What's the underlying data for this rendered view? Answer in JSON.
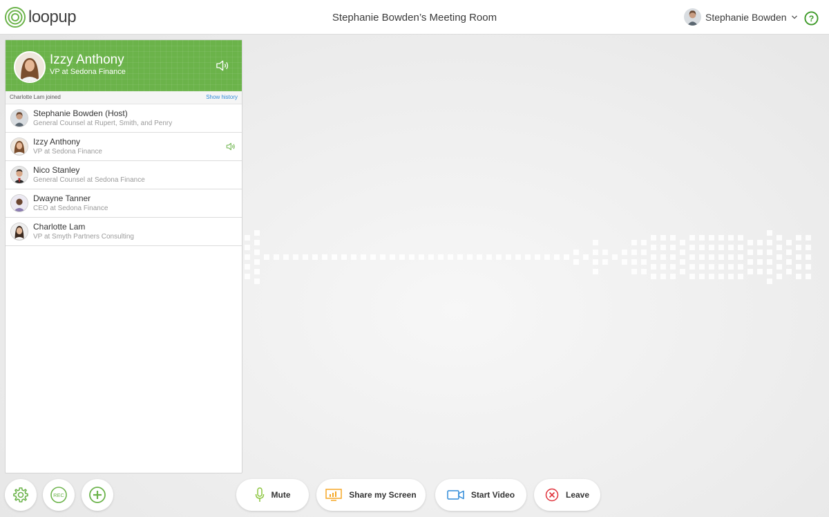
{
  "brand": {
    "name": "loopup",
    "color": "#6bb34a"
  },
  "header": {
    "room_title": "Stephanie Bowden’s Meeting Room",
    "user_name": "Stephanie Bowden",
    "help_icon": "help-circle-icon"
  },
  "active_speaker": {
    "name": "Izzy Anthony",
    "title": "VP at Sedona Finance"
  },
  "activity": {
    "text": "Charlotte Lam joined",
    "history_link": "Show history"
  },
  "participants": [
    {
      "name": "Stephanie Bowden (Host)",
      "title": "General Counsel at Rupert, Smith, and Penry",
      "speaking": false
    },
    {
      "name": "Izzy Anthony",
      "title": "VP at Sedona Finance",
      "speaking": true
    },
    {
      "name": "Nico Stanley",
      "title": "General Counsel at Sedona Finance",
      "speaking": false
    },
    {
      "name": "Dwayne Tanner",
      "title": "CEO at Sedona Finance",
      "speaking": false
    },
    {
      "name": "Charlotte Lam",
      "title": "VP at Smyth Partners Consulting",
      "speaking": false
    }
  ],
  "toolbar": {
    "settings_icon": "gear-icon",
    "record_icon": "rec-icon",
    "record_label": "REC",
    "add_icon": "plus-circle-icon",
    "mute_label": "Mute",
    "share_label": "Share my Screen",
    "video_label": "Start Video",
    "leave_label": "Leave"
  },
  "colors": {
    "green": "#6bb34a",
    "link_blue": "#2e8ad8",
    "mic_green": "#8cc63f",
    "share_orange": "#f5a623",
    "video_blue": "#2e8ad8",
    "leave_red": "#e0313a"
  },
  "audio_levels": [
    0.5,
    0.64,
    0.64,
    0.5,
    0.64,
    0.36,
    0.21,
    0.07,
    0.07,
    0.07,
    0.07,
    0.07,
    0.07,
    0.21,
    0.07,
    0.21,
    0.14,
    0.07,
    0.14,
    0.07,
    0.07,
    0.07,
    0.14,
    0.07,
    0.14,
    0.21,
    0.07,
    0.07,
    0.07,
    0.07,
    0.07,
    0.07,
    0.07,
    0.07,
    0.07,
    0.07,
    0.07,
    0.14,
    0.07,
    0.07,
    0.07,
    0.07,
    0.07,
    0.14,
    0.07,
    0.07,
    0.21,
    0.21,
    0.14,
    0.07,
    0.07,
    0.07,
    0.07,
    0.07,
    0.07,
    0.07,
    0.07,
    0.07,
    0.07,
    0.07,
    0.07,
    0.14,
    0.07,
    0.07,
    0.07,
    0.21,
    0.14,
    0.07,
    0.07,
    0.07,
    0.07,
    0.07,
    0.07,
    0.07,
    0.07,
    0.07,
    0.07,
    0.07,
    0.07,
    0.07,
    0.07,
    0.07,
    0.07,
    0.07,
    0.07,
    0.07,
    0.07,
    0.07,
    0.07,
    0.14,
    0.07,
    0.07,
    0.07,
    0.14,
    0.14,
    0.21,
    0.14,
    0.14,
    0.07,
    0.07,
    0.07,
    0.07,
    0.07,
    0.07,
    0.07,
    0.07,
    0.07,
    0.07,
    0.07,
    0.07,
    0.07,
    0.07,
    0.07,
    0.07,
    0.07,
    0.07,
    0.14,
    0.14,
    0.07,
    0.14,
    0.14,
    0.07,
    0.07,
    0.07,
    0.07,
    0.07,
    0.07,
    0.07,
    0.07,
    0.07,
    0.07,
    0.07,
    0.07,
    0.07,
    0.07,
    0.07,
    0.21,
    0.07,
    0.07,
    0.14,
    0.07,
    0.07,
    0.14,
    0.07,
    0.36,
    0.14,
    0.07,
    0.21,
    0.21,
    0.07,
    0.21,
    0.36,
    0.14,
    0.07,
    0.21,
    0.21,
    0.21,
    0.14,
    0.07,
    0.07,
    0.36,
    0.5,
    0.64,
    0.5,
    0.36,
    0.21,
    0.64,
    0.5,
    0.5,
    0.64,
    0.14,
    0.36,
    0.5,
    0.5,
    0.36,
    0.21,
    0.5,
    0.5,
    0.36,
    0.64,
    0.36,
    0.5,
    0.5,
    0.14,
    0.5,
    0.36,
    0.36,
    0.36,
    0.5,
    0.36,
    0.5,
    0.5,
    0.5,
    0.36,
    0.36,
    0.21,
    0.5,
    0.36,
    0.64,
    0.36,
    0.5,
    0.64,
    0.36,
    0.5,
    0.5,
    0.36,
    0.64,
    0.5,
    0.36,
    0.36,
    0.21,
    0.5,
    0.36,
    0.36,
    0.5,
    0.5,
    0.64,
    0.5,
    0.36,
    0.36,
    0.5,
    0.5,
    0.64,
    0.64,
    0.36,
    0.5,
    0.36,
    0.36,
    0.5,
    0.5,
    0.64,
    0.5,
    0.5
  ]
}
